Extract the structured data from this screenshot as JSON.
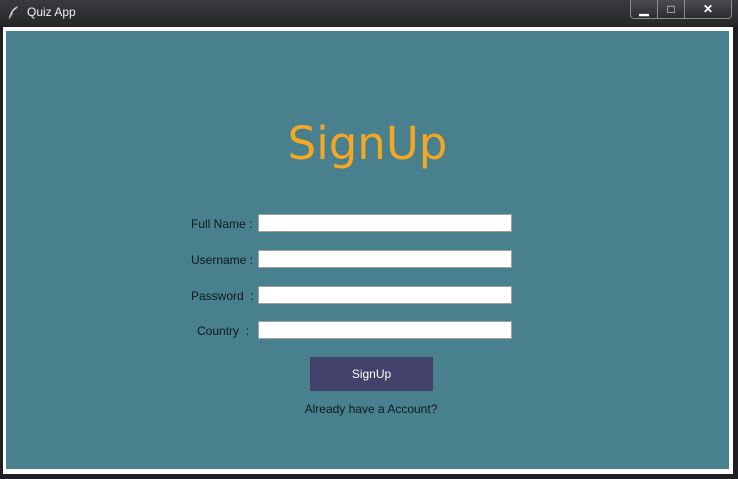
{
  "window": {
    "title": "Quiz App",
    "controls": {
      "minimize": "▁",
      "maximize": "□",
      "close": "✕"
    }
  },
  "form": {
    "heading": "SignUp",
    "fields": [
      {
        "label": "Full Name :",
        "value": ""
      },
      {
        "label": "Username :",
        "value": ""
      },
      {
        "label": "Password  :",
        "value": ""
      },
      {
        "label": "Country  :",
        "value": ""
      }
    ],
    "submit_label": "SignUp",
    "login_link": "Already have a Account?"
  },
  "colors": {
    "background": "#48818d",
    "heading": "#f5a623",
    "button": "#41416a"
  }
}
